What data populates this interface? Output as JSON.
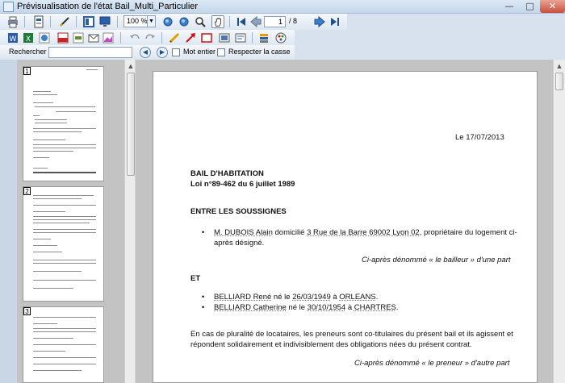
{
  "window": {
    "title": "Prévisualisation de l'état Bail_Multi_Particulier",
    "min_glyph": "—",
    "max_glyph": "□",
    "close_glyph": "✕"
  },
  "toolbar": {
    "zoom_value": "100 %",
    "page_current": "1",
    "page_total": "/ 8"
  },
  "search": {
    "label": "Rechercher :",
    "value": "",
    "whole_word_label": "Mot entier",
    "match_case_label": "Respecter la casse"
  },
  "thumbnails": [
    {
      "number": "1"
    },
    {
      "number": "2"
    },
    {
      "number": "3"
    }
  ],
  "document": {
    "date_line": "Le 17/07/2013",
    "heading1": "BAIL D'HABITATION",
    "heading2": "Loi n°89-462 du 6 juillet 1989",
    "section_parties": "ENTRE LES SOUSSIGNES",
    "landlord": {
      "name": "M. DUBOIS Alain",
      "text1": " domicilié ",
      "address": "3 Rue de la Barre 69002 Lyon 02",
      "text2": ", propriétaire du logement ci-",
      "text3": "après désigné."
    },
    "landlord_caption": "Ci-après dénommé « le bailleur » d'une part",
    "et": "ET",
    "tenants": [
      {
        "name": "BELLIARD René",
        "mid": " né le ",
        "date": "26/03/1949",
        "to": " à ",
        "city": "ORLEANS",
        "end": "."
      },
      {
        "name": "BELLIARD Catherine",
        "mid": " né le ",
        "date": "30/10/1954",
        "to": " à ",
        "city": "CHARTRES",
        "end": "."
      }
    ],
    "para1_line1": "En cas de pluralité de locataires, les preneurs sont co-titulaires du présent bail et ils agissent et",
    "para1_line2": "répondent solidairement et indivisiblement des obligations nées du présent contrat.",
    "tenant_caption": "Ci-après dénommé « le preneur » d'autre part"
  }
}
